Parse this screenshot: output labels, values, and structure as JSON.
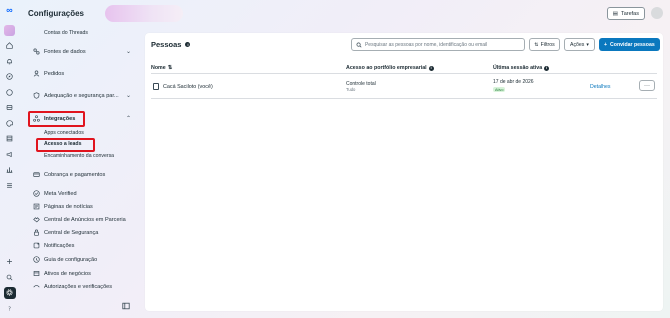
{
  "app": {
    "logo_glyph": "∞",
    "page_title": "Configurações"
  },
  "header": {
    "tasks_label": "Tarefas"
  },
  "sidebar": {
    "items": [
      {
        "key": "contas-threads",
        "label": "Contas do Threads",
        "icon": "none",
        "sub": true
      },
      {
        "key": "fontes-dados",
        "label": "Fontes de dados",
        "icon": "data-sources-icon",
        "chevron": "down"
      },
      {
        "key": "pedidos",
        "label": "Pedidos",
        "icon": "person-icon"
      },
      {
        "key": "adequacao",
        "label": "Adequação e segurança par...",
        "icon": "shield-icon",
        "chevron": "down"
      },
      {
        "key": "integracoes",
        "label": "Integrações",
        "icon": "integrations-icon",
        "chevron": "up"
      },
      {
        "key": "cobranca",
        "label": "Cobrança e pagamentos",
        "icon": "billing-icon"
      },
      {
        "key": "meta-verified",
        "label": "Meta Verified",
        "icon": "verified-icon"
      },
      {
        "key": "paginas-noticias",
        "label": "Páginas de notícias",
        "icon": "news-icon"
      },
      {
        "key": "central-anuncios",
        "label": "Central de Anúncios em Parceria",
        "icon": "partnership-icon"
      },
      {
        "key": "central-seguranca",
        "label": "Central de Segurança",
        "icon": "security-icon"
      },
      {
        "key": "notificacoes",
        "label": "Notificações",
        "icon": "notification-icon"
      },
      {
        "key": "guia-config",
        "label": "Guia de configuração",
        "icon": "guide-icon"
      },
      {
        "key": "ativos-negocios",
        "label": "Ativos de negócios",
        "icon": "assets-icon"
      },
      {
        "key": "autorizacoes",
        "label": "Autorizações e verificações",
        "icon": "authorization-icon"
      }
    ],
    "integrations_sub": [
      {
        "label": "Apps conectados"
      },
      {
        "label": "Acesso a leads"
      },
      {
        "label": "Encaminhamento da conversa"
      }
    ]
  },
  "panel": {
    "title": "Pessoas",
    "search_placeholder": "Pesquisar as pessoas por nome, identificação ou email",
    "filters_label": "Filtros",
    "actions_label": "Ações",
    "invite_label": "Convidar pessoas",
    "columns": {
      "name": "Nome",
      "access": "Acesso ao portfólio empresarial",
      "last_session": "Última sessão ativa"
    },
    "rows": [
      {
        "name": "Cacá Saciloto (você)",
        "access": "Controle total",
        "access_sub": "Tudo",
        "last_session": "17 de abr de 2026",
        "status": "Ativo",
        "details": "Detalhes",
        "more": "···"
      }
    ]
  },
  "colors": {
    "accent": "#0a78be",
    "highlight": "#e0141e",
    "active_badge_bg": "#d8f3da"
  }
}
